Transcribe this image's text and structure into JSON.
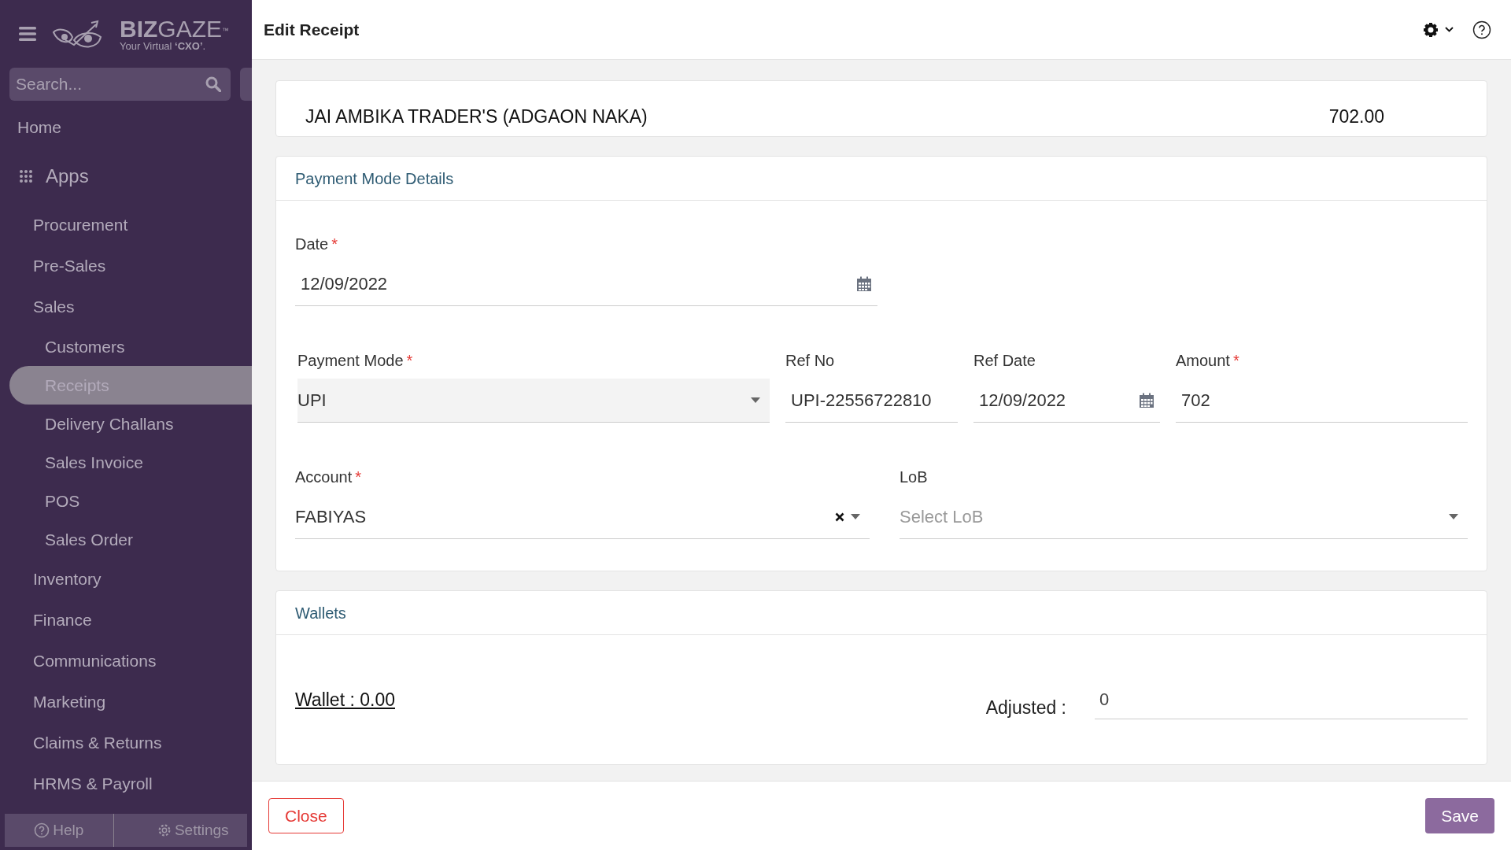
{
  "sidebar": {
    "brand": {
      "name_bold": "BIZ",
      "name": "GAZE",
      "trademark": "™",
      "tagline": "Your Virtual **‘CXO’**."
    },
    "search": {
      "placeholder": "Search..."
    },
    "nav": [
      {
        "kind": "link",
        "label": "Home"
      },
      {
        "kind": "section",
        "label": "Apps"
      },
      {
        "kind": "group",
        "label": "Procurement"
      },
      {
        "kind": "group",
        "label": "Pre-Sales"
      },
      {
        "kind": "group",
        "label": "Sales",
        "children": [
          {
            "label": "Customers",
            "selected": false
          },
          {
            "label": "Receipts",
            "selected": true
          },
          {
            "label": "Delivery Challans",
            "selected": false
          },
          {
            "label": "Sales Invoice",
            "selected": false
          },
          {
            "label": "POS",
            "selected": false
          },
          {
            "label": "Sales Order",
            "selected": false
          }
        ]
      },
      {
        "kind": "group",
        "label": "Inventory"
      },
      {
        "kind": "group",
        "label": "Finance"
      },
      {
        "kind": "group",
        "label": "Communications"
      },
      {
        "kind": "group",
        "label": "Marketing"
      },
      {
        "kind": "group",
        "label": "Claims & Returns"
      },
      {
        "kind": "group",
        "label": "HRMS & Payroll"
      }
    ],
    "footer": [
      {
        "kind": "help",
        "label": "Help"
      },
      {
        "kind": "settings",
        "label": "Settings"
      }
    ]
  },
  "header": {
    "title": "Edit Receipt"
  },
  "party": {
    "name": "JAI AMBIKA TRADER'S (ADGAON NAKA)",
    "amount": "702.00"
  },
  "payment_section": {
    "title": "Payment Mode Details",
    "rows": [
      [
        {
          "kind": "date",
          "label": "Date",
          "required_mark": "*",
          "value": "12/09/2022"
        }
      ],
      [
        {
          "kind": "select",
          "label": "Payment Mode",
          "required_mark": "*",
          "value": "UPI"
        },
        {
          "kind": "text",
          "label": "Ref No",
          "value": "UPI-22556722810"
        },
        {
          "kind": "date",
          "label": "Ref Date",
          "value": "12/09/2022"
        },
        {
          "kind": "text",
          "label": "Amount",
          "required_mark": "*",
          "value": "702"
        }
      ],
      [
        {
          "kind": "combo",
          "label": "Account",
          "required_mark": "*",
          "value": "FABIYAS"
        },
        {
          "kind": "combo",
          "label": "LoB",
          "placeholder": "Select LoB"
        }
      ]
    ]
  },
  "wallets_section": {
    "title": "Wallets",
    "wallet_link": "Wallet : 0.00",
    "adjusted_label": "Adjusted :",
    "adjusted_value": "0"
  },
  "buttons": [
    {
      "kind": "close",
      "label": "Close"
    },
    {
      "kind": "save",
      "label": "Save"
    }
  ]
}
